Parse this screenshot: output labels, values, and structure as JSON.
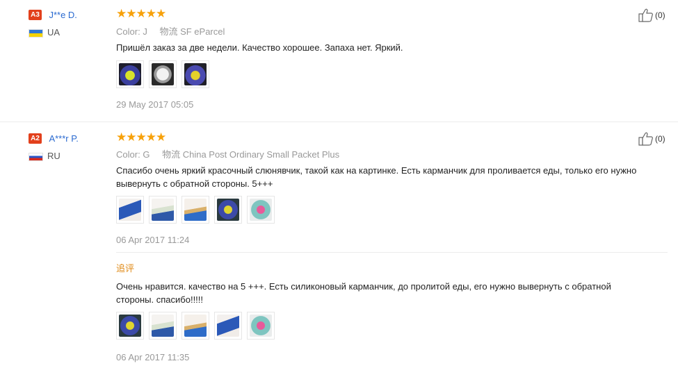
{
  "reviews": [
    {
      "level": "A3",
      "name": "J**e D.",
      "country": "UA",
      "stars": "★★★★★",
      "color_label": "Color:",
      "color_value": "J",
      "shipping_label": "物流",
      "shipping_value": "SF eParcel",
      "text": "Пришёл заказ за две недели. Качество хорошее. Запаха нет. Яркий.",
      "photos": [
        "ph-a",
        "ph-b",
        "ph-c"
      ],
      "date": "29 May 2017 05:05",
      "likes": "(0)"
    },
    {
      "level": "A2",
      "name": "A***r P.",
      "country": "RU",
      "stars": "★★★★★",
      "color_label": "Color:",
      "color_value": "G",
      "shipping_label": "物流",
      "shipping_value": "China Post Ordinary Small Packet Plus",
      "text": "Спасибо очень яркий красочный слюнявчик, такой как на картинке. Есть карманчик для проливается еды, только его нужно вывернуть с обратной стороны. 5+++",
      "photos": [
        "ph-d",
        "ph-e",
        "ph-f",
        "ph-g",
        "ph-h"
      ],
      "date": "06 Apr 2017 11:24",
      "likes": "(0)",
      "followup": {
        "label": "追评",
        "text": "Очень нравится. качество на 5 +++. Есть силиконовый карманчик, до пролитой еды, его нужно вывернуть с обратной стороны. спасибо!!!!!",
        "photos": [
          "ph-d",
          "ph-e",
          "ph-f",
          "ph-g",
          "ph-h"
        ],
        "date": "06 Apr 2017 11:35"
      }
    }
  ],
  "colors": {
    "accent_stars": "#f7a10a",
    "level_badge": "#e2401c",
    "username": "#2a6ad0",
    "followup_label": "#e08a17"
  },
  "icons": {
    "like": "thumbs-up-icon",
    "flag_ua": "flag-ua-icon",
    "flag_ru": "flag-ru-icon",
    "star": "star-icon"
  }
}
